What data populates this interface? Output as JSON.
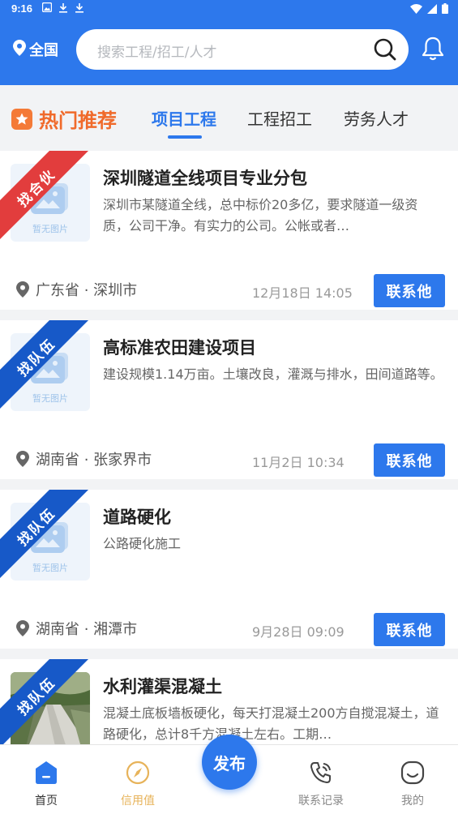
{
  "status_bar": {
    "time": "9:16"
  },
  "header": {
    "location": "全国",
    "search_placeholder": "搜索工程/招工/人才"
  },
  "tabs": {
    "hot_label": "热门推荐",
    "items": [
      "项目工程",
      "工程招工",
      "劳务人才"
    ],
    "active": "项目工程"
  },
  "thumb_placeholder": "暂无图片",
  "contact_label": "联系他",
  "cards": [
    {
      "badge": "找合伙",
      "title": "深圳隧道全线项目专业分包",
      "desc": "深圳市某隧道全线，总中标价20多亿，要求隧道一级资质，公司干净。有实力的公司。公帐或者…",
      "location": "广东省 · 深圳市",
      "time": "12月18日 14:05"
    },
    {
      "badge": "找队伍",
      "title": "高标准农田建设项目",
      "desc": "建设规模1.14万亩。土壤改良，灌溉与排水，田间道路等。",
      "location": "湖南省 · 张家界市",
      "time": "11月2日 10:34"
    },
    {
      "badge": "找队伍",
      "title": "道路硬化",
      "desc": "公路硬化施工",
      "location": "湖南省 · 湘潭市",
      "time": "9月28日 09:09"
    },
    {
      "badge": "找队伍",
      "title": "水利灌渠混凝土",
      "desc": "混凝土底板墙板硬化，每天打混凝土200方自搅混凝土，道路硬化，总计8千方混凝土左右。工期…"
    }
  ],
  "bottom_nav": {
    "home": "首页",
    "credit": "信用值",
    "publish": "发布",
    "records": "联系记录",
    "mine": "我的"
  }
}
